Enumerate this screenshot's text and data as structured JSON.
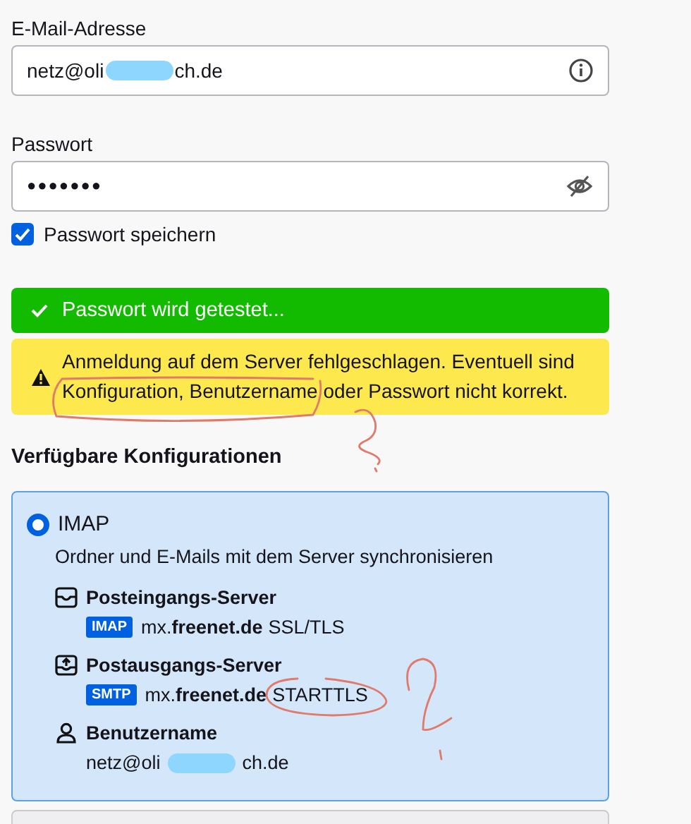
{
  "email": {
    "label": "E-Mail-Adresse",
    "value_parts": [
      "netz@oli",
      "ch.de"
    ]
  },
  "password": {
    "label": "Passwort",
    "value": "●●●●●●●"
  },
  "remember": {
    "label": "Passwort speichern",
    "checked": true
  },
  "status": {
    "text": "Passwort wird getestet..."
  },
  "warning": {
    "text": "Anmeldung auf dem Server fehlgeschlagen. Eventuell sind Konfiguration, Benutzername oder Passwort nicht korrekt."
  },
  "configs_heading": "Verfügbare Konfigurationen",
  "config": {
    "title": "IMAP",
    "selected": true,
    "description": "Ordner und E-Mails mit dem Server synchronisieren",
    "sections": [
      {
        "kind": "incoming",
        "heading": "Posteingangs-Server",
        "badge": "IMAP",
        "host_prefix": "mx.",
        "host_domain": "freenet.de",
        "security": "SSL/TLS"
      },
      {
        "kind": "outgoing",
        "heading": "Postausgangs-Server",
        "badge": "SMTP",
        "host_prefix": "mx.",
        "host_domain": "freenet.de",
        "security": "STARTTLS"
      },
      {
        "kind": "user",
        "heading": "Benutzername",
        "value_parts": [
          "netz@oli",
          "ch.de"
        ]
      }
    ]
  }
}
